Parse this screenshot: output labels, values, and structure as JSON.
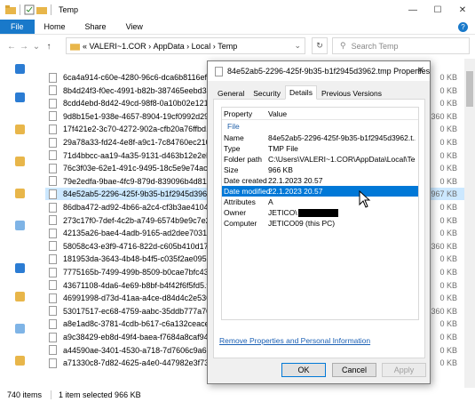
{
  "window": {
    "title": "Temp"
  },
  "ribbon": {
    "tabs": [
      "File",
      "Home",
      "Share",
      "View"
    ],
    "help_icon": "help-icon"
  },
  "address": {
    "path": [
      "«",
      "VALERI~1.COR",
      "AppData",
      "Local",
      "Temp"
    ],
    "search_placeholder": "Search Temp"
  },
  "files": [
    {
      "name": "6ca4a914-c60e-4280-96c6-dca6b8116ef7.tmp",
      "size": "0 KB"
    },
    {
      "name": "8b4d24f3-f0ec-4991-b82b-387465eebd34.tmp",
      "size": "0 KB"
    },
    {
      "name": "8cdd4ebd-8d42-49cd-98f8-0a10b02e1212.tmp",
      "size": "0 KB"
    },
    {
      "name": "9d8b15e1-938e-4657-8904-19cf0992d290.tmp",
      "size": "3 360 KB"
    },
    {
      "name": "17f421e2-3c70-4272-902a-cfb20a76ffbd.tmp",
      "size": "0 KB"
    },
    {
      "name": "29a78a33-fd24-4e8f-a9c1-7c84760ec210.tmp",
      "size": "0 KB"
    },
    {
      "name": "71d4bbcc-aa19-4a35-9131-d463b12e2eb2.tmp",
      "size": "0 KB"
    },
    {
      "name": "76c3f03e-62e1-491c-9495-18c5e9e74ac5.tmp",
      "size": "0 KB"
    },
    {
      "name": "79e2edfa-9bae-4fc9-879d-839096b4d811.tmp",
      "size": "0 KB"
    },
    {
      "name": "84e52ab5-2296-425f-9b35-b1f2945d3962.tmp",
      "size": "967 KB"
    },
    {
      "name": "86dba472-ad92-4b66-a2c4-cf3b3ae41049.tmp",
      "size": "0 KB"
    },
    {
      "name": "273c17f0-7def-4c2b-a749-6574b9e9c7e2.tmp",
      "size": "0 KB"
    },
    {
      "name": "42135a26-bae4-4adb-9165-ad2dee703149.tmp",
      "size": "0 KB"
    },
    {
      "name": "58058c43-e3f9-4716-822d-c605b410d178.tmp",
      "size": "3 360 KB"
    },
    {
      "name": "181953da-3643-4b48-b4f5-c035f2ae0955.tmp",
      "size": "0 KB"
    },
    {
      "name": "7775165b-7499-499b-8509-b0cae7bfc43f.tmp",
      "size": "0 KB"
    },
    {
      "name": "43671108-4da6-4e69-b8bf-b4f42f6f5fd5.tmp",
      "size": "0 KB"
    },
    {
      "name": "46991998-d73d-41aa-a4ce-d84d4c2e5363.tmp",
      "size": "0 KB"
    },
    {
      "name": "53017517-ec68-4759-aabc-35ddb777a702.tmp",
      "size": "3 360 KB"
    },
    {
      "name": "a8e1ad8c-3781-4cdb-b617-c6a132ceacec.tmp",
      "size": "0 KB"
    },
    {
      "name": "a9c38429-eb8d-49f4-baea-f7684a8caf94.tmp",
      "size": "0 KB"
    },
    {
      "name": "a44590ae-3401-4530-a718-7d7606c9a69e.tmp",
      "size": "0 KB"
    },
    {
      "name": "a71330c8-7d82-4625-a4e0-447982e3f731.tmp",
      "size": "0 KB"
    }
  ],
  "selected_index": 9,
  "status": {
    "items": "740 items",
    "selected": "1 item selected  966 KB"
  },
  "dialog": {
    "title": "84e52ab5-2296-425f-9b35-b1f2945d3962.tmp Properties",
    "tabs": [
      "General",
      "Security",
      "Details",
      "Previous Versions"
    ],
    "active_tab": "Details",
    "table_headers": {
      "property": "Property",
      "value": "Value"
    },
    "section": "File",
    "properties": [
      {
        "key": "Name",
        "value": "84e52ab5-2296-425f-9b35-b1f2945d3962.t..."
      },
      {
        "key": "Type",
        "value": "TMP File"
      },
      {
        "key": "Folder path",
        "value": "C:\\Users\\VALERI~1.COR\\AppData\\Local\\Te..."
      },
      {
        "key": "Size",
        "value": "966 KB"
      },
      {
        "key": "Date created",
        "value": "22.1.2023 20.57"
      },
      {
        "key": "Date modified",
        "value": "22.1.2023 20.57"
      },
      {
        "key": "Attributes",
        "value": "A"
      },
      {
        "key": "Owner",
        "value": "JETICO\\"
      },
      {
        "key": "Computer",
        "value": "JETICO09 (this PC)"
      }
    ],
    "selected_property": "Date modified",
    "remove_link": "Remove Properties and Personal Information",
    "buttons": {
      "ok": "OK",
      "cancel": "Cancel",
      "apply": "Apply"
    }
  },
  "colors": {
    "accent": "#1979ca",
    "selection": "#0078d7",
    "row_selected": "#cce8ff"
  }
}
